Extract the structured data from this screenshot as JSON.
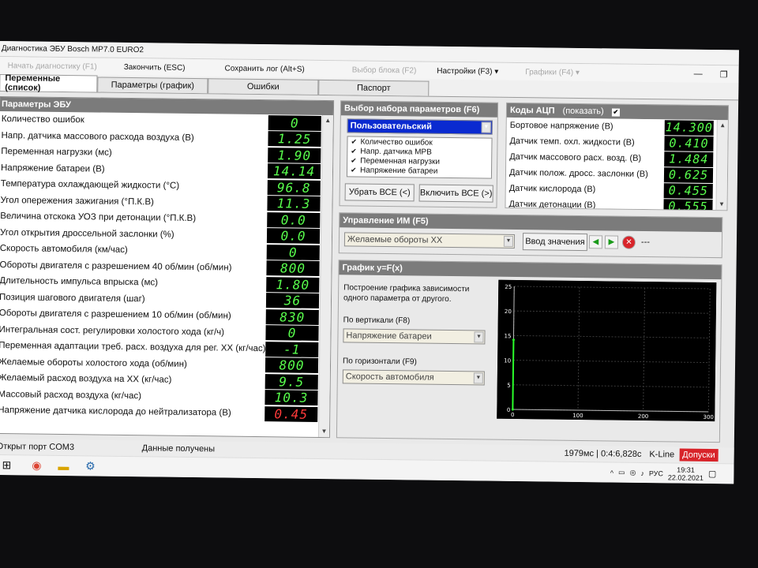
{
  "window": {
    "title": "Диагностика ЭБУ Bosch MP7.0 EURO2",
    "minimize": "—",
    "maximize": "❐"
  },
  "toolbar": [
    {
      "label": "Начать диагностику (F1)",
      "enabled": false
    },
    {
      "label": "Закончить (ESC)",
      "enabled": true
    },
    {
      "label": "Сохранить лог (Alt+S)",
      "enabled": true
    },
    {
      "label": "Выбор блока (F2)",
      "enabled": false
    },
    {
      "label": "Настройки (F3) ▾",
      "enabled": true
    },
    {
      "label": "Графики (F4) ▾",
      "enabled": false
    }
  ],
  "tabs": [
    "Переменные (список)",
    "Параметры (график)",
    "Ошибки",
    "Паспорт"
  ],
  "params": {
    "title": "Параметры ЭБУ",
    "rows": [
      {
        "label": "Количество ошибок",
        "value": "0"
      },
      {
        "label": "Напр. датчика массового расхода воздуха (В)",
        "value": "1.25"
      },
      {
        "label": "Переменная нагрузки (мс)",
        "value": "1.90"
      },
      {
        "label": "Напряжение батареи (В)",
        "value": "14.14"
      },
      {
        "label": "Температура охлаждающей жидкости (°С)",
        "value": "96.8"
      },
      {
        "label": "Угол опережения зажигания (°П.К.В)",
        "value": "11.3"
      },
      {
        "label": "Величина отскока УОЗ при детонации (°П.К.В)",
        "value": "0.0"
      },
      {
        "label": "Угол открытия дроссельной заслонки (%)",
        "value": "0.0"
      },
      {
        "label": "Скорость автомобиля (км/час)",
        "value": "0"
      },
      {
        "label": "Обороты двигателя с разрешением 40 об/мин (об/мин)",
        "value": "800"
      },
      {
        "label": "Длительность импульса впрыска (мс)",
        "value": "1.80"
      },
      {
        "label": "Позиция шагового двигателя (шаг)",
        "value": "36"
      },
      {
        "label": "Обороты двигателя с разрешением 10 об/мин (об/мин)",
        "value": "830"
      },
      {
        "label": "Интегральная сост. регулировки холостого хода (кг/ч)",
        "value": "0"
      },
      {
        "label": "Переменная адаптации треб. расх. воздуха для рег. ХХ (кг/час)",
        "value": "-1"
      },
      {
        "label": "Желаемые обороты холостого хода (об/мин)",
        "value": "800"
      },
      {
        "label": "Желаемый расход воздуха на ХХ (кг/час)",
        "value": "9.5"
      },
      {
        "label": "Массовый расход воздуха (кг/час)",
        "value": "10.3"
      },
      {
        "label": "Напряжение датчика кислорода до нейтрализатора (В)",
        "value": "0.45"
      }
    ]
  },
  "param_set": {
    "title": "Выбор набора параметров (F6)",
    "selected": "Пользовательский",
    "items": [
      "Количество ошибок",
      "Напр. датчика МРВ",
      "Переменная нагрузки",
      "Напряжение батареи"
    ],
    "remove_all": "Убрать ВСЕ (<)",
    "add_all": "Включить ВСЕ (>)"
  },
  "adc": {
    "title": "Коды АЦП",
    "show_label": "(показать)",
    "rows": [
      {
        "label": "Бортовое напряжение (В)",
        "value": "14.300"
      },
      {
        "label": "Датчик темп. охл. жидкости (В)",
        "value": "0.410"
      },
      {
        "label": "Датчик массового расх. возд. (В)",
        "value": "1.484"
      },
      {
        "label": "Датчик полож. дросс. заслонки (В)",
        "value": "0.625"
      },
      {
        "label": "Датчик кислорода (В)",
        "value": "0.455"
      },
      {
        "label": "Датчик детонации (В)",
        "value": "0.555"
      }
    ]
  },
  "control": {
    "title": "Управление ИМ (F5)",
    "selected": "Желаемые обороты ХХ",
    "input_button": "Ввод значения",
    "value_text": "---"
  },
  "graph": {
    "title": "График y=F(x)",
    "description": "Построение графика зависимости одного параметра от другого.",
    "vertical_label": "По вертикали (F8)",
    "vertical_value": "Напряжение батареи",
    "horizontal_label": "По горизонтали (F9)",
    "horizontal_value": "Скорость автомобиля"
  },
  "chart_data": {
    "type": "scatter",
    "x": [
      0,
      0
    ],
    "y": [
      0,
      14.14
    ],
    "xlim": [
      0,
      300
    ],
    "ylim": [
      0,
      25
    ],
    "xticks": [
      "0",
      "100",
      "200",
      "300"
    ],
    "yticks": [
      "0",
      "5",
      "10",
      "15",
      "20",
      "25"
    ],
    "grid": true,
    "line_color": "#2aff2a"
  },
  "status": {
    "port": "Открыт порт COM3",
    "data": "Данные получены",
    "timing": "1979мс | 0:4:6,828с",
    "protocol": "K-Line",
    "errors_badge": "Допуски"
  },
  "taskbar": {
    "lang": "РУС",
    "time": "19:31",
    "date": "22.02.2021"
  }
}
